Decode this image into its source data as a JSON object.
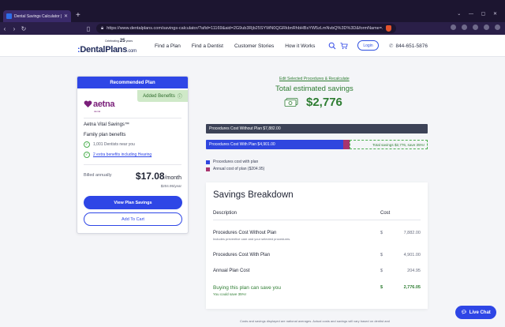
{
  "browser": {
    "tab_title": "Dental Savings Calculator | De",
    "url": "https://www.dentalplans.com/savings-calculator/?afid=11169&aid=2G9ub3Rjb25SYWN0QGRkbnRhbHBsYW5zLmNvbQ%3D%3D&formName=...",
    "new_tab_label": "+",
    "close_tab": "✕"
  },
  "site": {
    "logo_celebrating": "Celebrating",
    "logo_years": "25",
    "logo_years_suffix": "years",
    "logo_main": "DentalPlans",
    "logo_dot": ":",
    "logo_com": ".com",
    "nav": [
      "Find a Plan",
      "Find a Dentist",
      "Customer Stories",
      "How it Works"
    ],
    "login_label": "Login",
    "phone": "844-651-5876"
  },
  "plan": {
    "header": "Recommended Plan",
    "added_benefits": "Added Benefits",
    "brand": "aetna",
    "brand_sub": "dental",
    "name": "Aetna Vital Savings™",
    "type": "Family plan benefits",
    "benefits": [
      {
        "text": "1,001 Dentists near you",
        "link": false
      },
      {
        "text": "2 extra benefits including Hearing",
        "link": true
      }
    ],
    "billed_label": "Billed annually",
    "monthly_price": "$17.08",
    "monthly_suffix": "/month",
    "yearly_price": "$204.95/year",
    "view_savings_label": "View Plan Savings",
    "add_to_cart_label": "Add To Cart"
  },
  "summary": {
    "edit_link": "Edit Selected Procedures & Recalculate",
    "total_title": "Total estimated savings",
    "total_amount": "$2,776",
    "bar_without_label": "Procedures Cost Without Plan $7,882.00",
    "bar_with_label": "Procedures Cost With Plan $4,901.00",
    "bar_savings_label": "Total savings $2,776, save 35%!",
    "legend": [
      {
        "label": "Procedures cost with plan",
        "color": "#2f46df"
      },
      {
        "label": "Annual cost of plan ($204.95)",
        "color": "#a8346e"
      }
    ]
  },
  "breakdown": {
    "title": "Savings Breakdown",
    "col_description": "Description",
    "col_cost": "Cost",
    "rows": [
      {
        "label": "Procedures Cost Without Plan",
        "sub": "Includes preventive care and your selected procedures.",
        "currency": "$",
        "amount": "7,882.00"
      },
      {
        "label": "Procedures Cost With Plan",
        "sub": "",
        "currency": "$",
        "amount": "4,901.00"
      },
      {
        "label": "Annual Plan Cost",
        "sub": "",
        "currency": "$",
        "amount": "204.95"
      }
    ],
    "total": {
      "label": "Buying this plan can save you",
      "sub": "You could save 35%!",
      "currency": "$",
      "amount": "2,776.05"
    }
  },
  "footnote": "Costs and savings displayed are national averages. Actual costs and savings will vary based on dentist and",
  "live_chat_label": "Live Chat",
  "colors": {
    "brand_blue": "#2e46e6",
    "savings_green": "#2e7d32",
    "plan_fee": "#a8346e",
    "dark_bar": "#3c4257"
  }
}
